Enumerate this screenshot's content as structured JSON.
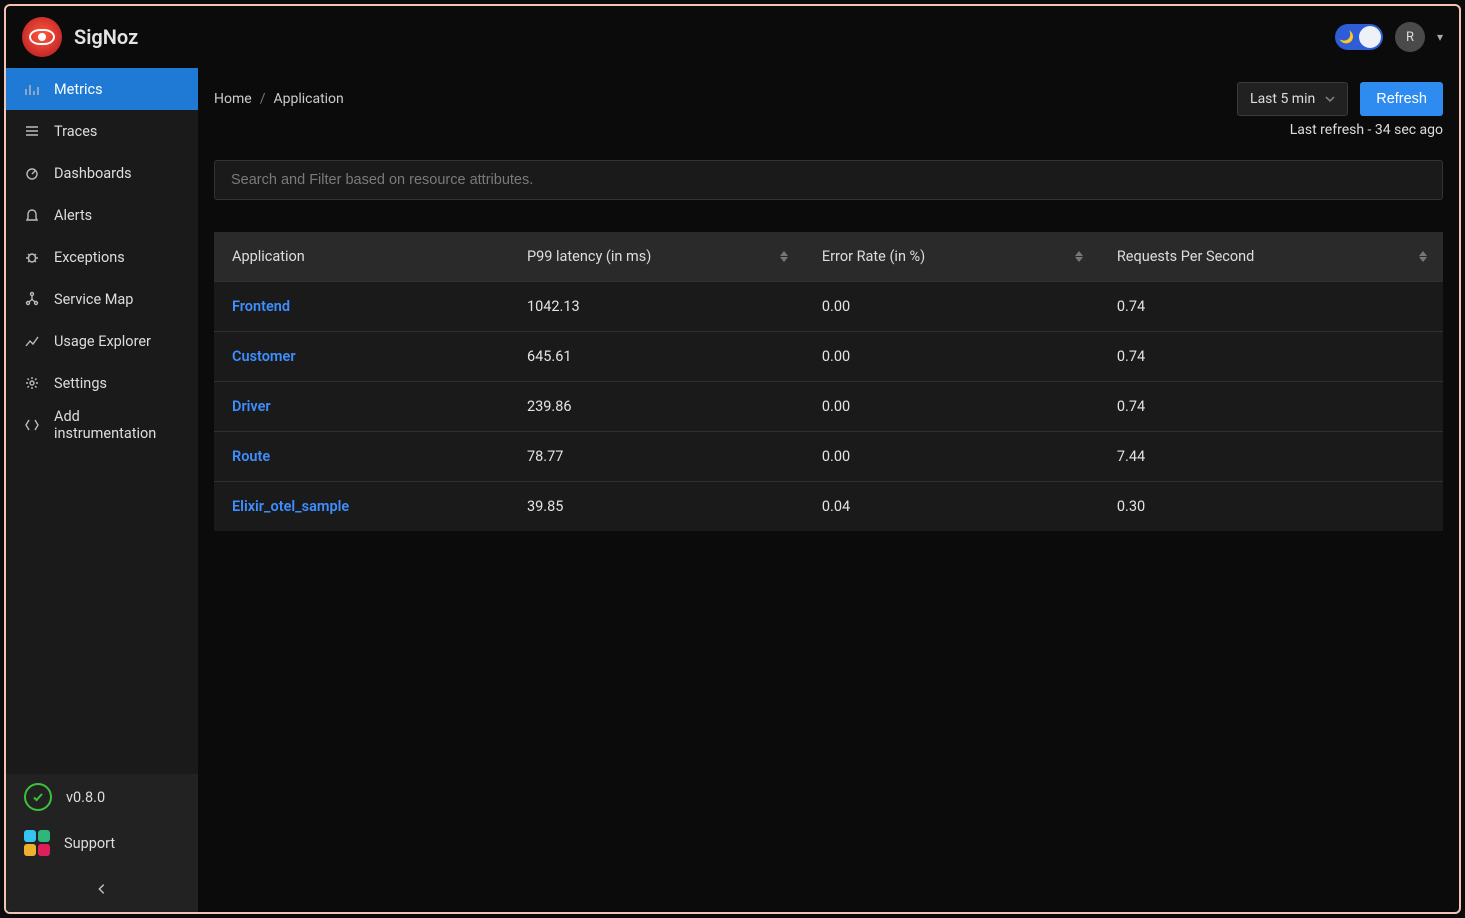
{
  "brand": "SigNoz",
  "header": {
    "avatar_initial": "R"
  },
  "sidebar": {
    "items": [
      {
        "label": "Metrics",
        "active": true
      },
      {
        "label": "Traces",
        "active": false
      },
      {
        "label": "Dashboards",
        "active": false
      },
      {
        "label": "Alerts",
        "active": false
      },
      {
        "label": "Exceptions",
        "active": false
      },
      {
        "label": "Service Map",
        "active": false
      },
      {
        "label": "Usage Explorer",
        "active": false
      },
      {
        "label": "Settings",
        "active": false
      },
      {
        "label": "Add instrumentation",
        "active": false
      }
    ],
    "version_label": "v0.8.0",
    "support_label": "Support"
  },
  "breadcrumb": {
    "home": "Home",
    "current": "Application"
  },
  "time_range": {
    "selected": "Last 5 min"
  },
  "refresh_label": "Refresh",
  "last_refresh": "Last refresh - 34 sec ago",
  "search": {
    "placeholder": "Search and Filter based on resource attributes."
  },
  "table": {
    "columns": {
      "application": "Application",
      "p99": "P99 latency (in ms)",
      "error": "Error Rate (in %)",
      "rps": "Requests Per Second"
    },
    "rows": [
      {
        "app": "Frontend",
        "p99": "1042.13",
        "error": "0.00",
        "rps": "0.74"
      },
      {
        "app": "Customer",
        "p99": "645.61",
        "error": "0.00",
        "rps": "0.74"
      },
      {
        "app": "Driver",
        "p99": "239.86",
        "error": "0.00",
        "rps": "0.74"
      },
      {
        "app": "Route",
        "p99": "78.77",
        "error": "0.00",
        "rps": "7.44"
      },
      {
        "app": "Elixir_otel_sample",
        "p99": "39.85",
        "error": "0.04",
        "rps": "0.30"
      }
    ]
  }
}
